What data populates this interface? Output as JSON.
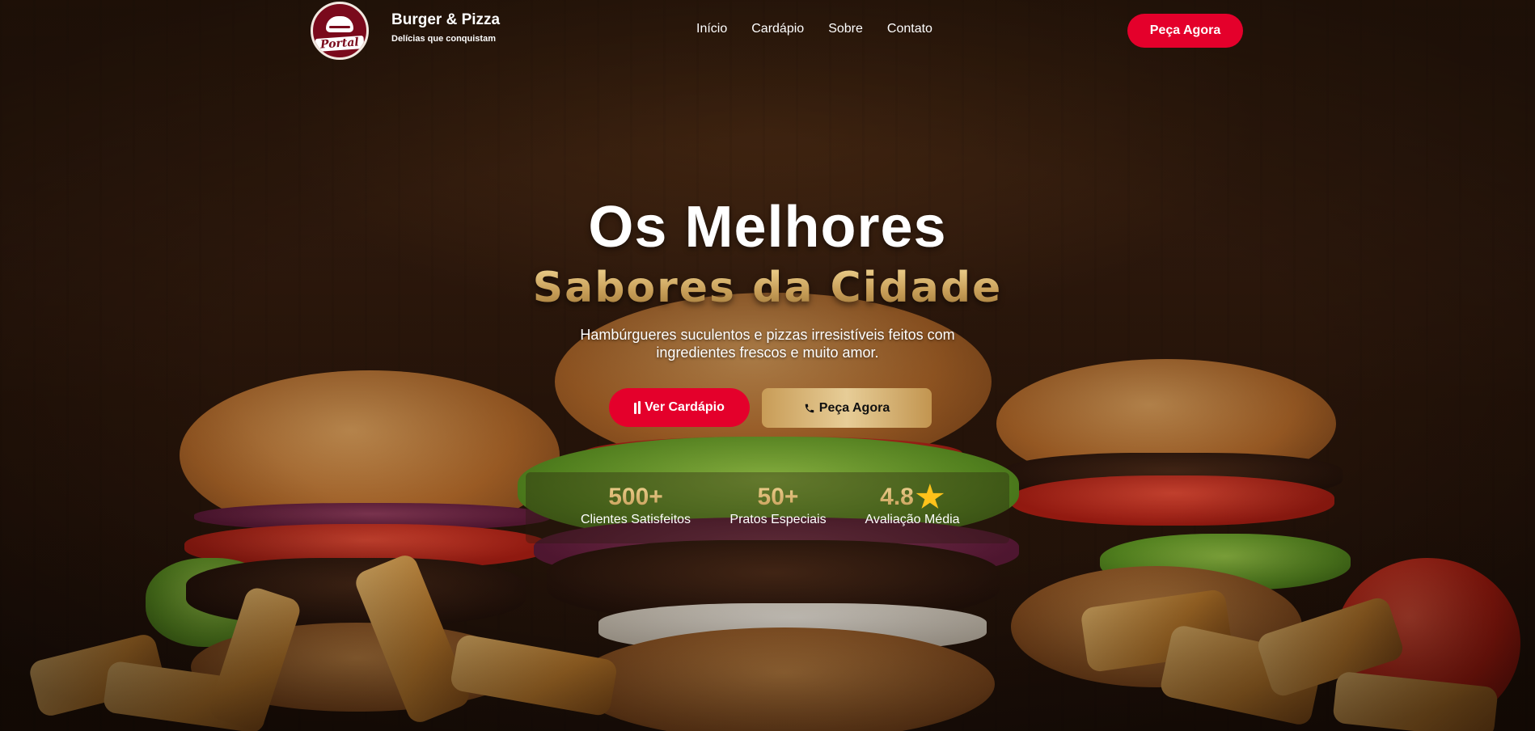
{
  "brand": {
    "name": "Burger & Pizza",
    "tagline": "Delícias que conquistam",
    "logo_text": "Portal"
  },
  "nav": {
    "items": [
      {
        "label": "Início"
      },
      {
        "label": "Cardápio"
      },
      {
        "label": "Sobre"
      },
      {
        "label": "Contato"
      }
    ],
    "cta_label": "Peça Agora"
  },
  "hero": {
    "title": "Os Melhores",
    "subtitle": "Sabores da Cidade",
    "description": "Hambúrgueres suculentos e pizzas irresistíveis feitos com ingredientes frescos e muito amor.",
    "primary_button": "Ver Cardápio",
    "secondary_button": "Peça Agora"
  },
  "stats": [
    {
      "value": "500+",
      "label": "Clientes Satisfeitos"
    },
    {
      "value": "50+",
      "label": "Pratos Especiais"
    },
    {
      "value": "4.8",
      "label": "Avaliação Média"
    }
  ],
  "colors": {
    "accent": "#e4002b",
    "gold": "#d4b06a",
    "star": "#ffc21a"
  },
  "icons": {
    "menu_button": "fork-knife-icon",
    "order_button": "phone-icon",
    "rating": "star-icon"
  }
}
